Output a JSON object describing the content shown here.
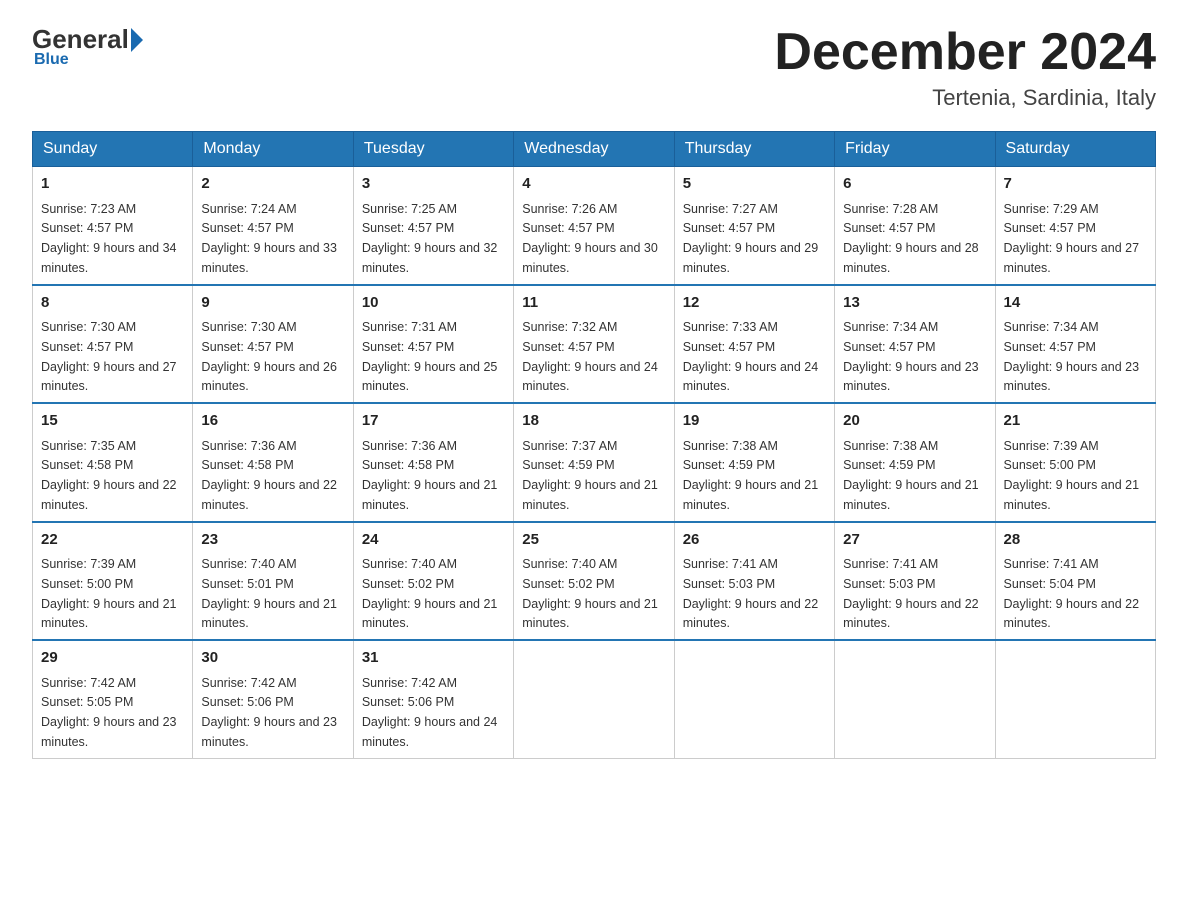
{
  "logo": {
    "general": "General",
    "arrow": "",
    "blue": "Blue",
    "subtitle": "Blue"
  },
  "header": {
    "title": "December 2024",
    "subtitle": "Tertenia, Sardinia, Italy"
  },
  "weekdays": [
    "Sunday",
    "Monday",
    "Tuesday",
    "Wednesday",
    "Thursday",
    "Friday",
    "Saturday"
  ],
  "weeks": [
    [
      {
        "day": "1",
        "sunrise": "7:23 AM",
        "sunset": "4:57 PM",
        "daylight": "9 hours and 34 minutes."
      },
      {
        "day": "2",
        "sunrise": "7:24 AM",
        "sunset": "4:57 PM",
        "daylight": "9 hours and 33 minutes."
      },
      {
        "day": "3",
        "sunrise": "7:25 AM",
        "sunset": "4:57 PM",
        "daylight": "9 hours and 32 minutes."
      },
      {
        "day": "4",
        "sunrise": "7:26 AM",
        "sunset": "4:57 PM",
        "daylight": "9 hours and 30 minutes."
      },
      {
        "day": "5",
        "sunrise": "7:27 AM",
        "sunset": "4:57 PM",
        "daylight": "9 hours and 29 minutes."
      },
      {
        "day": "6",
        "sunrise": "7:28 AM",
        "sunset": "4:57 PM",
        "daylight": "9 hours and 28 minutes."
      },
      {
        "day": "7",
        "sunrise": "7:29 AM",
        "sunset": "4:57 PM",
        "daylight": "9 hours and 27 minutes."
      }
    ],
    [
      {
        "day": "8",
        "sunrise": "7:30 AM",
        "sunset": "4:57 PM",
        "daylight": "9 hours and 27 minutes."
      },
      {
        "day": "9",
        "sunrise": "7:30 AM",
        "sunset": "4:57 PM",
        "daylight": "9 hours and 26 minutes."
      },
      {
        "day": "10",
        "sunrise": "7:31 AM",
        "sunset": "4:57 PM",
        "daylight": "9 hours and 25 minutes."
      },
      {
        "day": "11",
        "sunrise": "7:32 AM",
        "sunset": "4:57 PM",
        "daylight": "9 hours and 24 minutes."
      },
      {
        "day": "12",
        "sunrise": "7:33 AM",
        "sunset": "4:57 PM",
        "daylight": "9 hours and 24 minutes."
      },
      {
        "day": "13",
        "sunrise": "7:34 AM",
        "sunset": "4:57 PM",
        "daylight": "9 hours and 23 minutes."
      },
      {
        "day": "14",
        "sunrise": "7:34 AM",
        "sunset": "4:57 PM",
        "daylight": "9 hours and 23 minutes."
      }
    ],
    [
      {
        "day": "15",
        "sunrise": "7:35 AM",
        "sunset": "4:58 PM",
        "daylight": "9 hours and 22 minutes."
      },
      {
        "day": "16",
        "sunrise": "7:36 AM",
        "sunset": "4:58 PM",
        "daylight": "9 hours and 22 minutes."
      },
      {
        "day": "17",
        "sunrise": "7:36 AM",
        "sunset": "4:58 PM",
        "daylight": "9 hours and 21 minutes."
      },
      {
        "day": "18",
        "sunrise": "7:37 AM",
        "sunset": "4:59 PM",
        "daylight": "9 hours and 21 minutes."
      },
      {
        "day": "19",
        "sunrise": "7:38 AM",
        "sunset": "4:59 PM",
        "daylight": "9 hours and 21 minutes."
      },
      {
        "day": "20",
        "sunrise": "7:38 AM",
        "sunset": "4:59 PM",
        "daylight": "9 hours and 21 minutes."
      },
      {
        "day": "21",
        "sunrise": "7:39 AM",
        "sunset": "5:00 PM",
        "daylight": "9 hours and 21 minutes."
      }
    ],
    [
      {
        "day": "22",
        "sunrise": "7:39 AM",
        "sunset": "5:00 PM",
        "daylight": "9 hours and 21 minutes."
      },
      {
        "day": "23",
        "sunrise": "7:40 AM",
        "sunset": "5:01 PM",
        "daylight": "9 hours and 21 minutes."
      },
      {
        "day": "24",
        "sunrise": "7:40 AM",
        "sunset": "5:02 PM",
        "daylight": "9 hours and 21 minutes."
      },
      {
        "day": "25",
        "sunrise": "7:40 AM",
        "sunset": "5:02 PM",
        "daylight": "9 hours and 21 minutes."
      },
      {
        "day": "26",
        "sunrise": "7:41 AM",
        "sunset": "5:03 PM",
        "daylight": "9 hours and 22 minutes."
      },
      {
        "day": "27",
        "sunrise": "7:41 AM",
        "sunset": "5:03 PM",
        "daylight": "9 hours and 22 minutes."
      },
      {
        "day": "28",
        "sunrise": "7:41 AM",
        "sunset": "5:04 PM",
        "daylight": "9 hours and 22 minutes."
      }
    ],
    [
      {
        "day": "29",
        "sunrise": "7:42 AM",
        "sunset": "5:05 PM",
        "daylight": "9 hours and 23 minutes."
      },
      {
        "day": "30",
        "sunrise": "7:42 AM",
        "sunset": "5:06 PM",
        "daylight": "9 hours and 23 minutes."
      },
      {
        "day": "31",
        "sunrise": "7:42 AM",
        "sunset": "5:06 PM",
        "daylight": "9 hours and 24 minutes."
      },
      null,
      null,
      null,
      null
    ]
  ],
  "labels": {
    "sunrise": "Sunrise:",
    "sunset": "Sunset:",
    "daylight": "Daylight:"
  }
}
